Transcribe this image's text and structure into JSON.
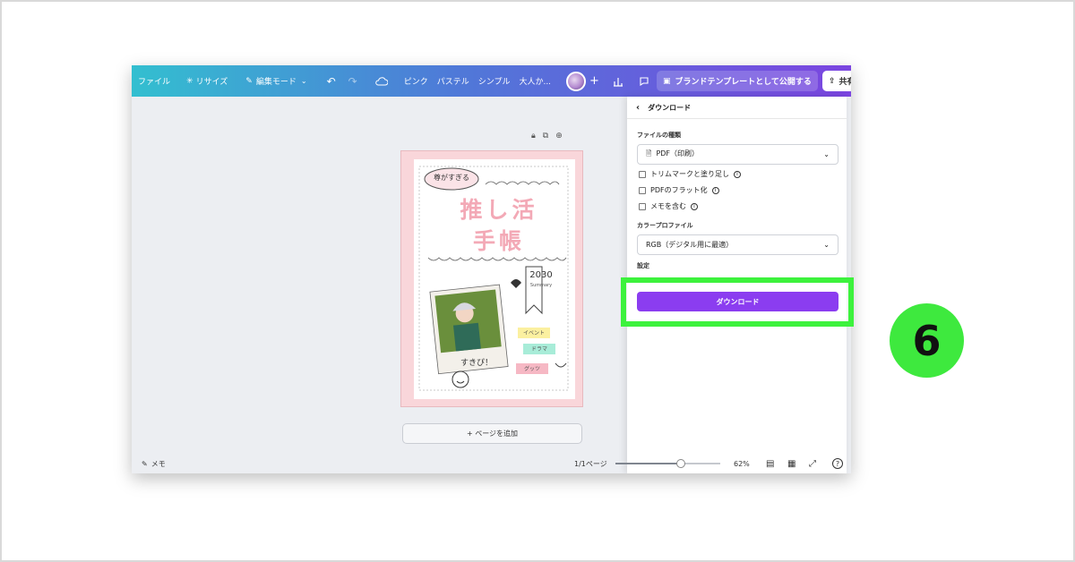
{
  "topbar": {
    "file": "ファイル",
    "resize": "リサイズ",
    "edit_mode": "編集モード",
    "tags": [
      "ピンク",
      "パステル",
      "シンプル",
      "大人か..."
    ],
    "brand_template": "ブランドテンプレートとして公開する",
    "share": "共有"
  },
  "canvas": {
    "add_page": "+ ページを追加"
  },
  "design": {
    "badge": "尊がすぎる",
    "title_line1": "推し活",
    "title_line2": "手帳",
    "year": "2030",
    "year_sub": "Summary",
    "caption": "すきぴ！",
    "tags": [
      "イベント",
      "ドラマ",
      "グッツ"
    ],
    "colors": {
      "pink": "#f3a9b6",
      "yellow": "#fbf0a0",
      "mint": "#a8ecd8",
      "rose": "#f6b8c4"
    }
  },
  "panel": {
    "title": "ダウンロード",
    "file_type_label": "ファイルの種類",
    "file_type_value": "PDF（印刷）",
    "options": [
      "トリムマークと塗り足し",
      "PDFのフラット化",
      "メモを含む"
    ],
    "color_profile_label": "カラープロファイル",
    "color_profile_value": "RGB（デジタル用に最適）",
    "settings_label": "設定",
    "download_button": "ダウンロード"
  },
  "bottombar": {
    "memo": "メモ",
    "page_indicator": "1/1ページ",
    "zoom": "62%",
    "zoom_level": 0.62
  },
  "step_badge": "6",
  "accent": {
    "highlight": "#3df23d",
    "button": "#8b3df0"
  }
}
